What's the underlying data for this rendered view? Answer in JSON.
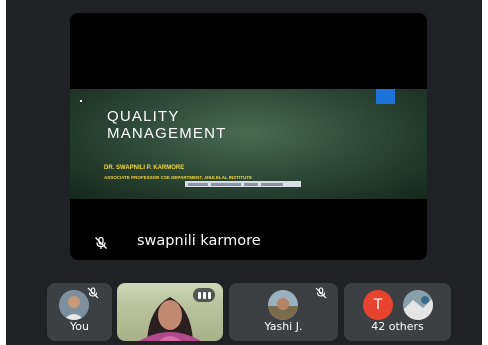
{
  "main": {
    "speaker_name": "swapnili karmore",
    "slide": {
      "title_line1": "QUALITY",
      "title_line2": "MANAGEMENT",
      "author": "DR. SWAPNILI P. KARMORE",
      "role": "ASSOCIATE PROFESSOR CSE DEPARTMENT, JHULELAL INSTITUTE"
    }
  },
  "participants": [
    {
      "label": "You"
    },
    {
      "label": ""
    },
    {
      "label": "Yashi J."
    },
    {
      "label": "42 others",
      "avatar_letter": "T"
    }
  ],
  "colors": {
    "background": "#202124",
    "tile": "#3c4043",
    "slide_square": "#1d74d8",
    "slide_text_yellow": "#f4d63c",
    "avatar_t": "#e8432e"
  },
  "icons": [
    "mic-off-icon",
    "mic-off-icon",
    "mic-off-icon",
    "tile-options-icon"
  ]
}
